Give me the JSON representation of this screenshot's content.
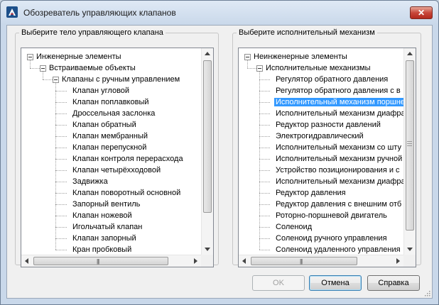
{
  "window": {
    "title": "Обозреватель управляющих клапанов",
    "close_label": "✕"
  },
  "left_panel": {
    "label": "Выберите тело управляющего клапана",
    "items": [
      {
        "text": "Инженерные элементы",
        "level": 0,
        "expanded": true
      },
      {
        "text": "Встраиваемые объекты",
        "level": 1,
        "expanded": true
      },
      {
        "text": "Клапаны с ручным управлением",
        "level": 2,
        "expanded": true
      },
      {
        "text": "Клапан угловой",
        "level": 3
      },
      {
        "text": "Клапан поплавковый",
        "level": 3
      },
      {
        "text": "Дроссельная заслонка",
        "level": 3
      },
      {
        "text": "Клапан обратный",
        "level": 3
      },
      {
        "text": "Клапан мембранный",
        "level": 3
      },
      {
        "text": "Клапан перепускной",
        "level": 3
      },
      {
        "text": "Клапан контроля перерасхода",
        "level": 3
      },
      {
        "text": "Клапан четырёхходовой",
        "level": 3
      },
      {
        "text": "Задвижка",
        "level": 3
      },
      {
        "text": "Клапан поворотный основной",
        "level": 3
      },
      {
        "text": "Запорный вентиль",
        "level": 3
      },
      {
        "text": "Клапан ножевой",
        "level": 3
      },
      {
        "text": "Игольчатый клапан",
        "level": 3
      },
      {
        "text": "Клапан запорный",
        "level": 3
      },
      {
        "text": "Кран пробковый",
        "level": 3
      }
    ]
  },
  "right_panel": {
    "label": "Выберите исполнительный механизм",
    "items": [
      {
        "text": "Неинженерные элементы",
        "level": 0,
        "expanded": true
      },
      {
        "text": "Исполнительные механизмы",
        "level": 1,
        "expanded": true
      },
      {
        "text": "Регулятор обратного давления",
        "level": 2
      },
      {
        "text": "Регулятор обратного давления с в",
        "level": 2
      },
      {
        "text": "Исполнительный механизм поршне",
        "level": 2,
        "selected": true
      },
      {
        "text": "Исполнительный механизм диафра",
        "level": 2
      },
      {
        "text": "Редуктор разности давлений",
        "level": 2
      },
      {
        "text": "Электрогидравлический",
        "level": 2
      },
      {
        "text": "Исполнительный механизм со шту",
        "level": 2
      },
      {
        "text": "Исполнительный механизм ручной",
        "level": 2
      },
      {
        "text": "Устройство позиционирования и с",
        "level": 2
      },
      {
        "text": "Исполнительный механизм диафра",
        "level": 2
      },
      {
        "text": "Редуктор давления",
        "level": 2
      },
      {
        "text": "Редуктор давления с внешним отб",
        "level": 2
      },
      {
        "text": "Роторно-поршневой двигатель",
        "level": 2
      },
      {
        "text": "Соленоид",
        "level": 2
      },
      {
        "text": "Соленоид ручного управления",
        "level": 2
      },
      {
        "text": "Соленоид удаленного управления",
        "level": 2
      }
    ]
  },
  "buttons": {
    "ok": "OK",
    "cancel": "Отмена",
    "help": "Справка"
  },
  "icons": {
    "app": "autocad-icon",
    "grip": "scroll-thumb-grip"
  },
  "colors": {
    "selection": "#3399ff",
    "title_bg": "#dfe9f5"
  }
}
